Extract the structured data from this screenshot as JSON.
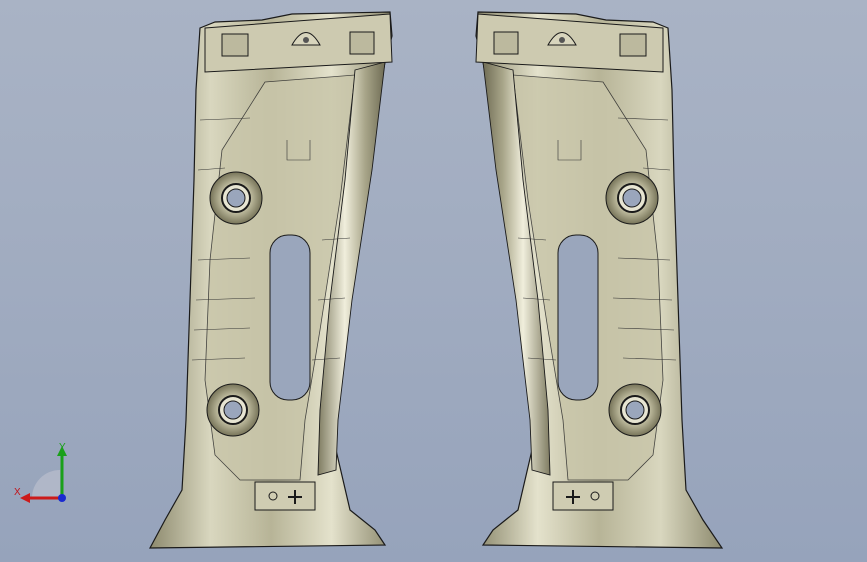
{
  "viewport": {
    "background_top": "#a9b3c5",
    "background_bottom": "#96a3bb"
  },
  "parts": [
    {
      "name": "left-pillar-trim",
      "fill": "#c8c5a8",
      "edge": "#1a1a1a"
    },
    {
      "name": "right-pillar-trim",
      "fill": "#c8c5a8",
      "edge": "#1a1a1a"
    }
  ],
  "triad": {
    "x_label": "X",
    "y_label": "Y",
    "x_color": "#cc1a1a",
    "y_color": "#1aa01a",
    "z_color": "#1a2ad0"
  }
}
